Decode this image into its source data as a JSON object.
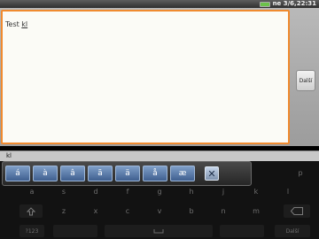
{
  "status_bar": {
    "text": "ne 3/6,22:31",
    "battery_color": "#6cc24a"
  },
  "editor": {
    "text_before": "Test ",
    "text_composing": "kl"
  },
  "next_button": {
    "label": "Další"
  },
  "suggestion": {
    "word": "kl"
  },
  "accent_popup": {
    "keys": [
      "á",
      "à",
      "â",
      "ã",
      "ä",
      "å",
      "æ"
    ],
    "close_label": "✕"
  },
  "keyboard": {
    "row1_right": "p",
    "row2": [
      "a",
      "s",
      "d",
      "f",
      "g",
      "h",
      "j",
      "k",
      "l"
    ],
    "row3": [
      "z",
      "x",
      "c",
      "v",
      "b",
      "n",
      "m"
    ],
    "symbols_label": "?123",
    "next_label": "Další",
    "shift_icon": "shift-arrow-icon",
    "backspace_icon": "backspace-icon"
  },
  "colors": {
    "accent_orange": "#f08a2e",
    "popup_key_blue": "#3f5f8f"
  }
}
